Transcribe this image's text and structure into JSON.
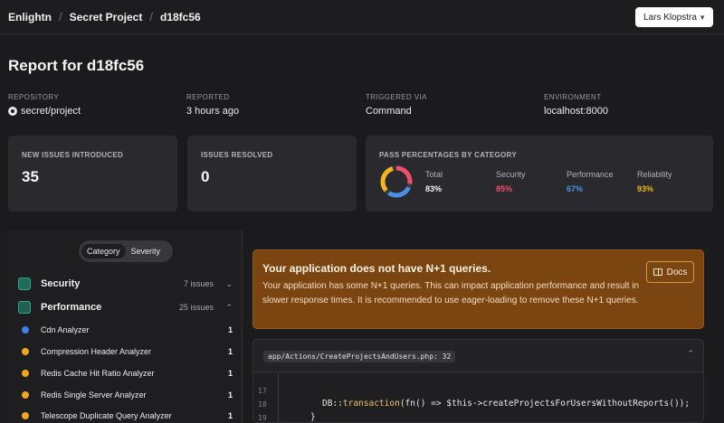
{
  "topbar": {
    "crumbs": [
      "Enlightn",
      "Secret Project",
      "d18fc56"
    ],
    "separator": "/",
    "user": "Lars Klopstra"
  },
  "header": {
    "title": "Report for d18fc56",
    "meta": [
      {
        "label": "Repository",
        "value": "secret/project"
      },
      {
        "label": "Reported",
        "value": "3 hours ago"
      },
      {
        "label": "Triggered via",
        "value": "Command"
      },
      {
        "label": "Environment",
        "value": "localhost:8000"
      }
    ],
    "cards": {
      "new_issues": {
        "label": "New issues introduced",
        "value": "35"
      },
      "resolved": {
        "label": "Issues resolved",
        "value": "0"
      },
      "pass": {
        "label": "Pass percentages by category",
        "stats": [
          {
            "name": "Total",
            "value": "83%",
            "color": "#f2f2f2"
          },
          {
            "name": "Security",
            "value": "85%",
            "color": "#f0506e"
          },
          {
            "name": "Performance",
            "value": "67%",
            "color": "#4a90e2"
          },
          {
            "name": "Reliability",
            "value": "93%",
            "color": "#f2b51e"
          }
        ]
      }
    }
  },
  "sidebar": {
    "tabs": [
      "Category",
      "Severity"
    ],
    "active_tab": "Category",
    "categories": [
      {
        "name": "Security",
        "count": "7 issues",
        "expanded": false
      },
      {
        "name": "Performance",
        "count": "25 issues",
        "expanded": true
      }
    ],
    "items": [
      {
        "name": "Cdn Analyzer",
        "count": "1",
        "color": "#3f7fe6"
      },
      {
        "name": "Compression Header Analyzer",
        "count": "1",
        "color": "#f2a51e"
      },
      {
        "name": "Redis Cache Hit Ratio Analyzer",
        "count": "1",
        "color": "#f2a51e"
      },
      {
        "name": "Redis Single Server Analyzer",
        "count": "1",
        "color": "#f2a51e"
      },
      {
        "name": "Telescope Duplicate Query Analyzer",
        "count": "1",
        "color": "#f2a51e"
      }
    ]
  },
  "alert": {
    "title": "Your application does not have N+1 queries.",
    "body": "Your application has some N+1 queries. This can impact application performance and result in slower response times. It is recommended to use eager-loading to remove these N+1 queries.",
    "docs_label": "Docs"
  },
  "code": {
    "file": "app/Actions/CreateProjectsAndUsers.php: 32",
    "lines": [
      {
        "number": "17",
        "pre": "",
        "fn": "",
        "post": ""
      },
      {
        "number": "18",
        "pre": "DB::",
        "fn": "transaction",
        "post": "(fn() => $this->createProjectsForUsersWithoutReports());"
      },
      {
        "number": "19",
        "pre": "}",
        "fn": "",
        "post": ""
      }
    ]
  }
}
